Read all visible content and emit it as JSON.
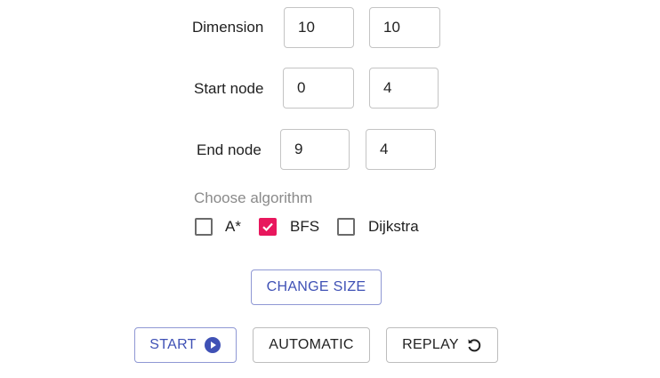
{
  "dimension": {
    "label": "Dimension",
    "values": [
      "10",
      "10"
    ]
  },
  "start_node": {
    "label": "Start node",
    "values": [
      "0",
      "4"
    ]
  },
  "end_node": {
    "label": "End node",
    "values": [
      "9",
      "4"
    ]
  },
  "algorithm": {
    "legend": "Choose algorithm",
    "options": [
      {
        "label": "A*",
        "checked": false
      },
      {
        "label": "BFS",
        "checked": true
      },
      {
        "label": "Dijkstra",
        "checked": false
      }
    ]
  },
  "buttons": {
    "change_size": "CHANGE SIZE",
    "start": "START",
    "automatic": "AUTOMATIC",
    "replay": "REPLAY"
  },
  "colors": {
    "accent": "#3f51b5",
    "checked": "#e8175d"
  },
  "icons": {
    "start": "play-circle-icon",
    "replay": "replay-icon"
  }
}
